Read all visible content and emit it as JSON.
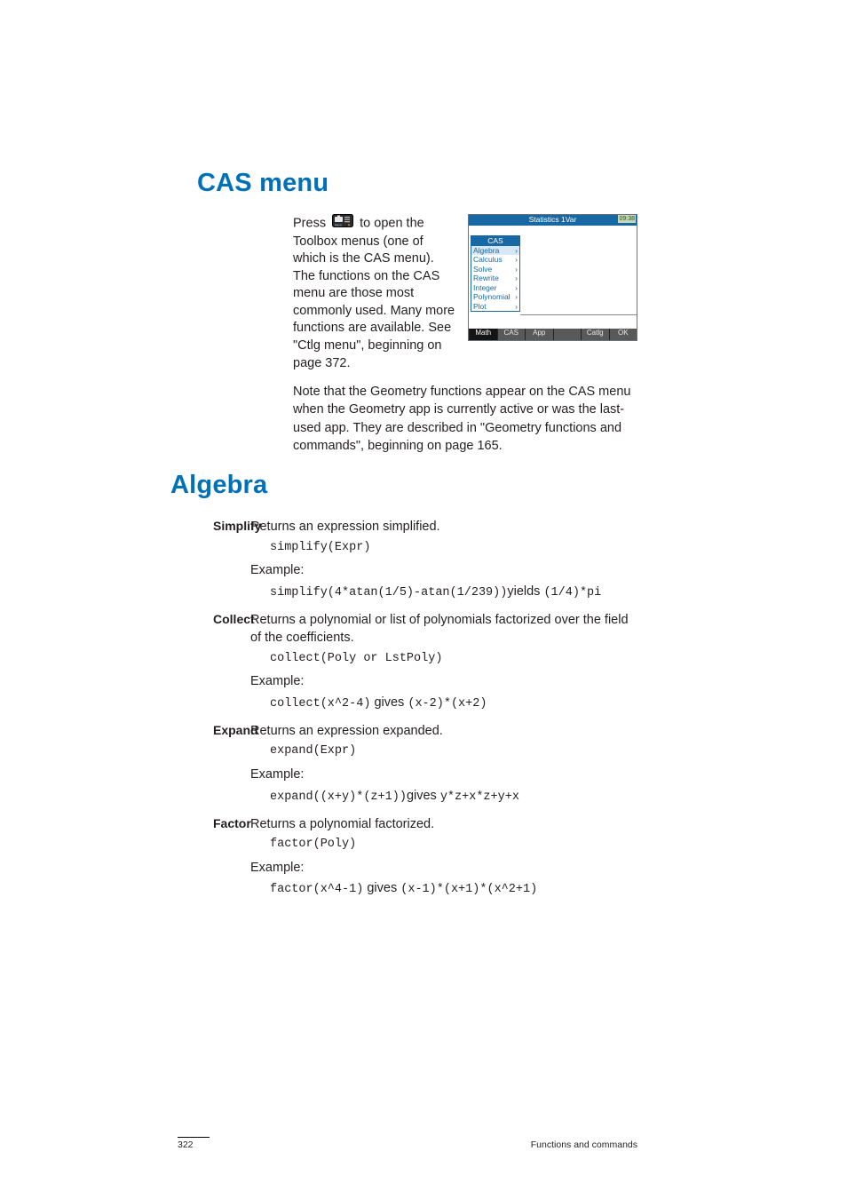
{
  "page": {
    "number": "322",
    "running_title": "Functions and commands"
  },
  "sec1": {
    "title": "CAS menu",
    "intro_pre": "Press",
    "intro_post": "to open the Toolbox menus (one of which is the CAS menu). The functions on the CAS menu are those most commonly used. Many more functions are available. See \"Ctlg menu\", beginning on page 372.",
    "note": "Note that the Geometry functions appear on the CAS menu when the Geometry app is currently active or was the last-used app. They are described in \"Geometry functions and commands\", beginning on page 165."
  },
  "calc": {
    "header": "Statistics 1Var",
    "time": "09:38",
    "menu_head": "CAS",
    "items": [
      "Algebra",
      "Calculus",
      "Solve",
      "Rewrite",
      "Integer",
      "Polynomial",
      "Plot"
    ],
    "softkeys": [
      "Math",
      "CAS",
      "App",
      "",
      "Catlg",
      "OK"
    ]
  },
  "sec2": {
    "title": "Algebra",
    "entries": [
      {
        "label": "Simplify",
        "desc": "Returns an expression simplified.",
        "syntax": "simplify(Expr)",
        "example_label": "Example:",
        "example_code_pre": "simplify(4*atan(1/5)-atan(1/239))",
        "example_join": "yields",
        "example_code_post": "(1/4)*pi"
      },
      {
        "label": "Collect",
        "desc": "Returns a polynomial or list of polynomials factorized over the field of the coefficients.",
        "syntax": "collect(Poly or LstPoly)",
        "example_label": "Example:",
        "example_code_pre": "collect(x^2-4)",
        "example_join": "gives",
        "example_code_post": "(x-2)*(x+2)"
      },
      {
        "label": "Expand",
        "desc": "Returns an expression expanded.",
        "syntax": "expand(Expr)",
        "example_label": "Example:",
        "example_code_pre": "expand((x+y)*(z+1))",
        "example_join": "gives",
        "example_code_post": "y*z+x*z+y+x"
      },
      {
        "label": "Factor",
        "desc": "Returns a polynomial factorized.",
        "syntax": "factor(Poly)",
        "example_label": "Example:",
        "example_code_pre": "factor(x^4-1)",
        "example_join": "gives",
        "example_code_post": "(x-1)*(x+1)*(x^2+1)"
      }
    ]
  }
}
